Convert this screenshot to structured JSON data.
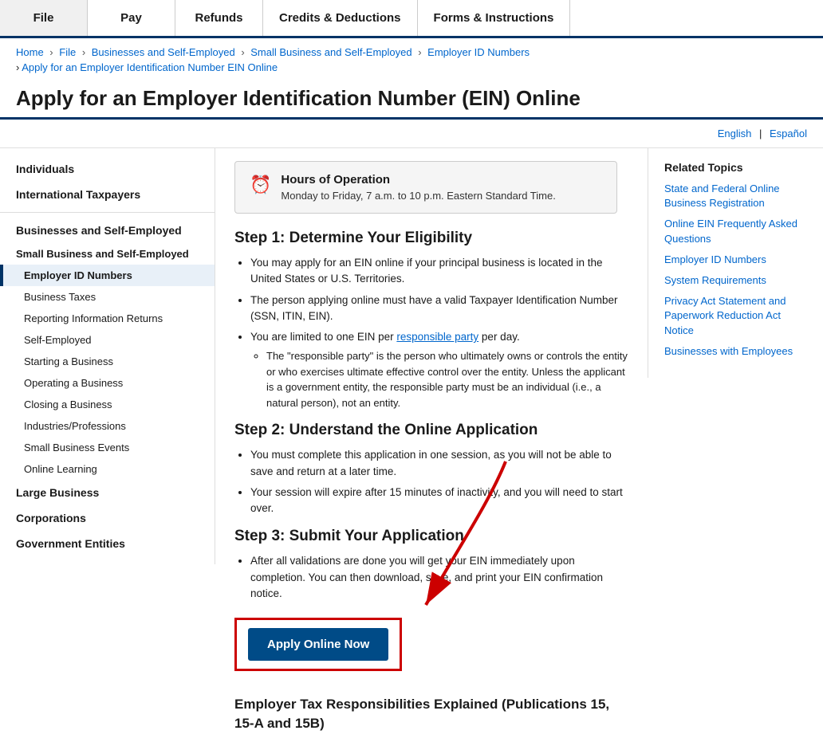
{
  "nav": {
    "items": [
      {
        "label": "File",
        "id": "file"
      },
      {
        "label": "Pay",
        "id": "pay"
      },
      {
        "label": "Refunds",
        "id": "refunds"
      },
      {
        "label": "Credits & Deductions",
        "id": "credits"
      },
      {
        "label": "Forms & Instructions",
        "id": "forms"
      }
    ]
  },
  "breadcrumb": {
    "items": [
      {
        "label": "Home",
        "href": "#"
      },
      {
        "label": "File",
        "href": "#"
      },
      {
        "label": "Businesses and Self-Employed",
        "href": "#"
      },
      {
        "label": "Small Business and Self-Employed",
        "href": "#"
      },
      {
        "label": "Employer ID Numbers",
        "href": "#"
      }
    ],
    "line2": "Apply for an Employer Identification Number EIN Online"
  },
  "page_title": "Apply for an Employer Identification Number (EIN) Online",
  "lang": {
    "english": "English",
    "separator": "|",
    "espanol": "Español"
  },
  "sidebar": {
    "sections": [
      {
        "label": "Individuals",
        "type": "section"
      },
      {
        "label": "International Taxpayers",
        "type": "section"
      },
      {
        "label": "Businesses and Self-Employed",
        "type": "section-active"
      },
      {
        "label": "Small Business and Self-Employed",
        "type": "subsection"
      },
      {
        "label": "Employer ID Numbers",
        "type": "item-active"
      },
      {
        "label": "Business Taxes",
        "type": "item"
      },
      {
        "label": "Reporting Information Returns",
        "type": "item"
      },
      {
        "label": "Self-Employed",
        "type": "item"
      },
      {
        "label": "Starting a Business",
        "type": "item"
      },
      {
        "label": "Operating a Business",
        "type": "item"
      },
      {
        "label": "Closing a Business",
        "type": "item"
      },
      {
        "label": "Industries/Professions",
        "type": "item"
      },
      {
        "label": "Small Business Events",
        "type": "item"
      },
      {
        "label": "Online Learning",
        "type": "item"
      },
      {
        "label": "Large Business",
        "type": "section"
      },
      {
        "label": "Corporations",
        "type": "section"
      },
      {
        "label": "Government Entities",
        "type": "section"
      }
    ]
  },
  "hours": {
    "title": "Hours of Operation",
    "text": "Monday to Friday, 7 a.m. to 10 p.m. Eastern Standard Time."
  },
  "steps": [
    {
      "id": "step1",
      "title": "Step 1: Determine Your Eligibility",
      "bullets": [
        "You may apply for an EIN online if your principal business is located in the United States or U.S. Territories.",
        "The person applying online must have a valid Taxpayer Identification Number (SSN, ITIN, EIN).",
        "You are limited to one EIN per responsible party per day.",
        "The \"responsible party\" is the person who ultimately owns or controls the entity or who exercises ultimate effective control over the entity. Unless the applicant is a government entity, the responsible party must be an individual (i.e., a natural person), not an entity."
      ],
      "sub_bullet_index": 3
    },
    {
      "id": "step2",
      "title": "Step 2: Understand the Online Application",
      "bullets": [
        "You must complete this application in one session, as you will not be able to save and return at a later time.",
        "Your session will expire after 15 minutes of inactivity, and you will need to start over."
      ]
    },
    {
      "id": "step3",
      "title": "Step 3: Submit Your Application",
      "bullets": [
        "After all validations are done you will get your EIN immediately upon completion. You can then download, save, and print your EIN confirmation notice."
      ]
    }
  ],
  "apply_button": "Apply Online Now",
  "employer_tax_title": "Employer Tax Responsibilities Explained\n(Publications 15, 15-A and 15B)",
  "related": {
    "title": "Related Topics",
    "items": [
      {
        "label": "State and Federal Online Business Registration",
        "href": "#"
      },
      {
        "label": "Online EIN Frequently Asked Questions",
        "href": "#"
      },
      {
        "label": "Employer ID Numbers",
        "href": "#"
      },
      {
        "label": "System Requirements",
        "href": "#"
      },
      {
        "label": "Privacy Act Statement and Paperwork Reduction Act Notice",
        "href": "#"
      },
      {
        "label": "Businesses with Employees",
        "href": "#"
      }
    ]
  }
}
